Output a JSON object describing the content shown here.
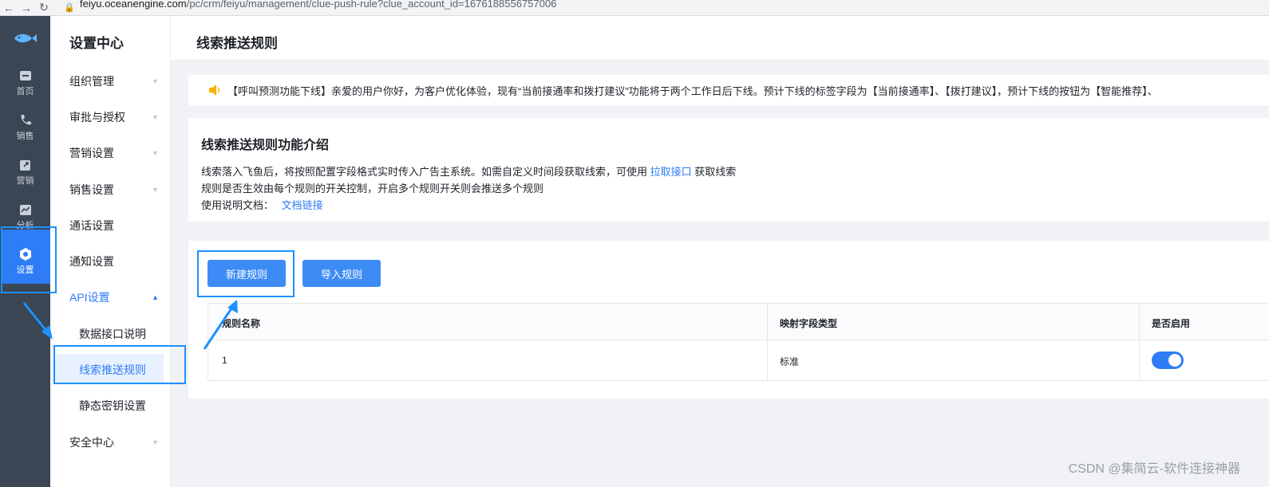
{
  "browser": {
    "url_host": "feiyu.oceanengine.com",
    "url_path": "/pc/crm/feiyu/management/clue-push-rule?clue_account_id=1676188556757006"
  },
  "leftbar": {
    "items": [
      {
        "label": "首页",
        "icon": "home-icon"
      },
      {
        "label": "销售",
        "icon": "phone-icon"
      },
      {
        "label": "营销",
        "icon": "share-icon"
      },
      {
        "label": "分析",
        "icon": "chart-icon"
      },
      {
        "label": "设置",
        "icon": "settings-icon",
        "active": true
      }
    ]
  },
  "menu": {
    "title": "设置中心",
    "items": [
      {
        "label": "组织管理"
      },
      {
        "label": "审批与授权"
      },
      {
        "label": "营销设置"
      },
      {
        "label": "销售设置"
      },
      {
        "label": "通话设置"
      },
      {
        "label": "通知设置"
      },
      {
        "label": "API设置",
        "open": true
      },
      {
        "label": "安全中心"
      }
    ],
    "sub_items": [
      {
        "label": "数据接口说明"
      },
      {
        "label": "线索推送规则",
        "active": true
      },
      {
        "label": "静态密钥设置"
      }
    ]
  },
  "header": {
    "title": "线索推送规则"
  },
  "notice": {
    "text": "【呼叫预测功能下线】亲爱的用户你好，为客户优化体验，现有“当前接通率和拨打建议”功能将于两个工作日后下线。预计下线的标签字段为【当前接通率】、【拨打建议】，预计下线的按钮为【智能推荐】、"
  },
  "intro": {
    "heading": "线索推送规则功能介绍",
    "line1_prefix": "线索落入飞鱼后，将按照配置字段格式实时传入广告主系统。如需自定义时间段获取线索，可使用",
    "line1_link": "拉取接口",
    "line1_suffix": "获取线索",
    "line2": "规则是否生效由每个规则的开关控制，开启多个规则开关则会推送多个规则",
    "line3_prefix": "使用说明文档：",
    "line3_link": "文档链接"
  },
  "actions": {
    "new_rule": "新建规则",
    "import_rule": "导入规则"
  },
  "table": {
    "columns": [
      "规则名称",
      "映射字段类型",
      "是否启用"
    ],
    "rows": [
      {
        "name": "1",
        "mapping_type": "标准",
        "enabled": true
      }
    ]
  },
  "watermark": "CSDN @集简云-软件连接神器",
  "colors": {
    "primary": "#2e7cf6",
    "sidebar_bg": "#3b4654",
    "highlight_border": "#1e90ff"
  }
}
